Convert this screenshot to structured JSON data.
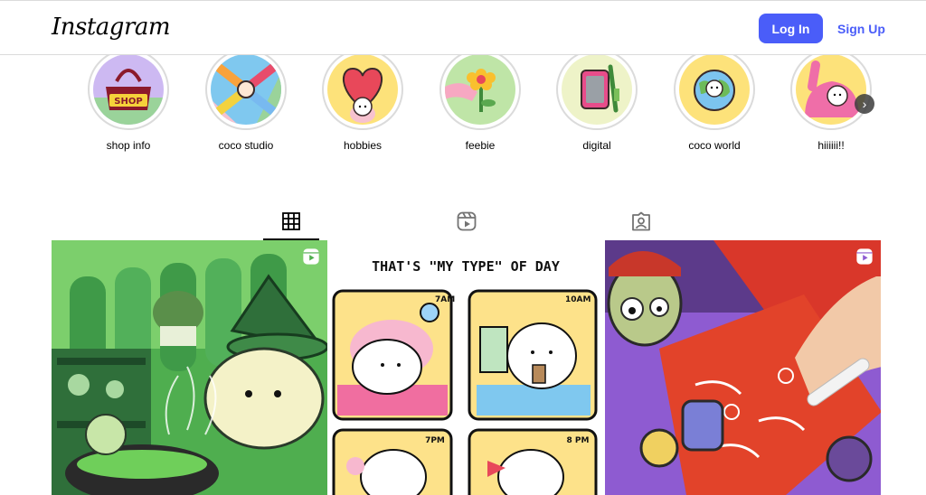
{
  "header": {
    "logo_text": "Instagram",
    "login_label": "Log In",
    "signup_label": "Sign Up"
  },
  "highlights": [
    {
      "label": "shop info",
      "icon": "shop-bag-icon",
      "bg": "#cdb9f2"
    },
    {
      "label": "coco studio",
      "icon": "hands-icon",
      "bg": "#7fc8ef"
    },
    {
      "label": "hobbies",
      "icon": "heart-icon",
      "bg": "#fde27a"
    },
    {
      "label": "feebie",
      "icon": "flower-icon",
      "bg": "#bfe5a7"
    },
    {
      "label": "digital",
      "icon": "tablet-icon",
      "bg": "#eef3c8"
    },
    {
      "label": "coco world",
      "icon": "globe-icon",
      "bg": "#fde27a"
    },
    {
      "label": "hiiiiii!!",
      "icon": "waving-icon",
      "bg": "#fde27a"
    }
  ],
  "tabs": [
    {
      "name": "posts",
      "icon": "grid-icon",
      "active": true
    },
    {
      "name": "reels",
      "icon": "reels-icon",
      "active": false
    },
    {
      "name": "tagged",
      "icon": "tagged-icon",
      "active": false
    }
  ],
  "posts": [
    {
      "kind": "reel",
      "scene": "witch-dog-green"
    },
    {
      "kind": "image",
      "title": "THAT'S \"MY TYPE\" OF DAY",
      "times": [
        "7AM",
        "10AM",
        "7PM",
        "8 PM"
      ]
    },
    {
      "kind": "reel",
      "scene": "zombie-coloring"
    }
  ],
  "colors": {
    "accent": "#4a5df9",
    "border": "#dbdbdb"
  }
}
